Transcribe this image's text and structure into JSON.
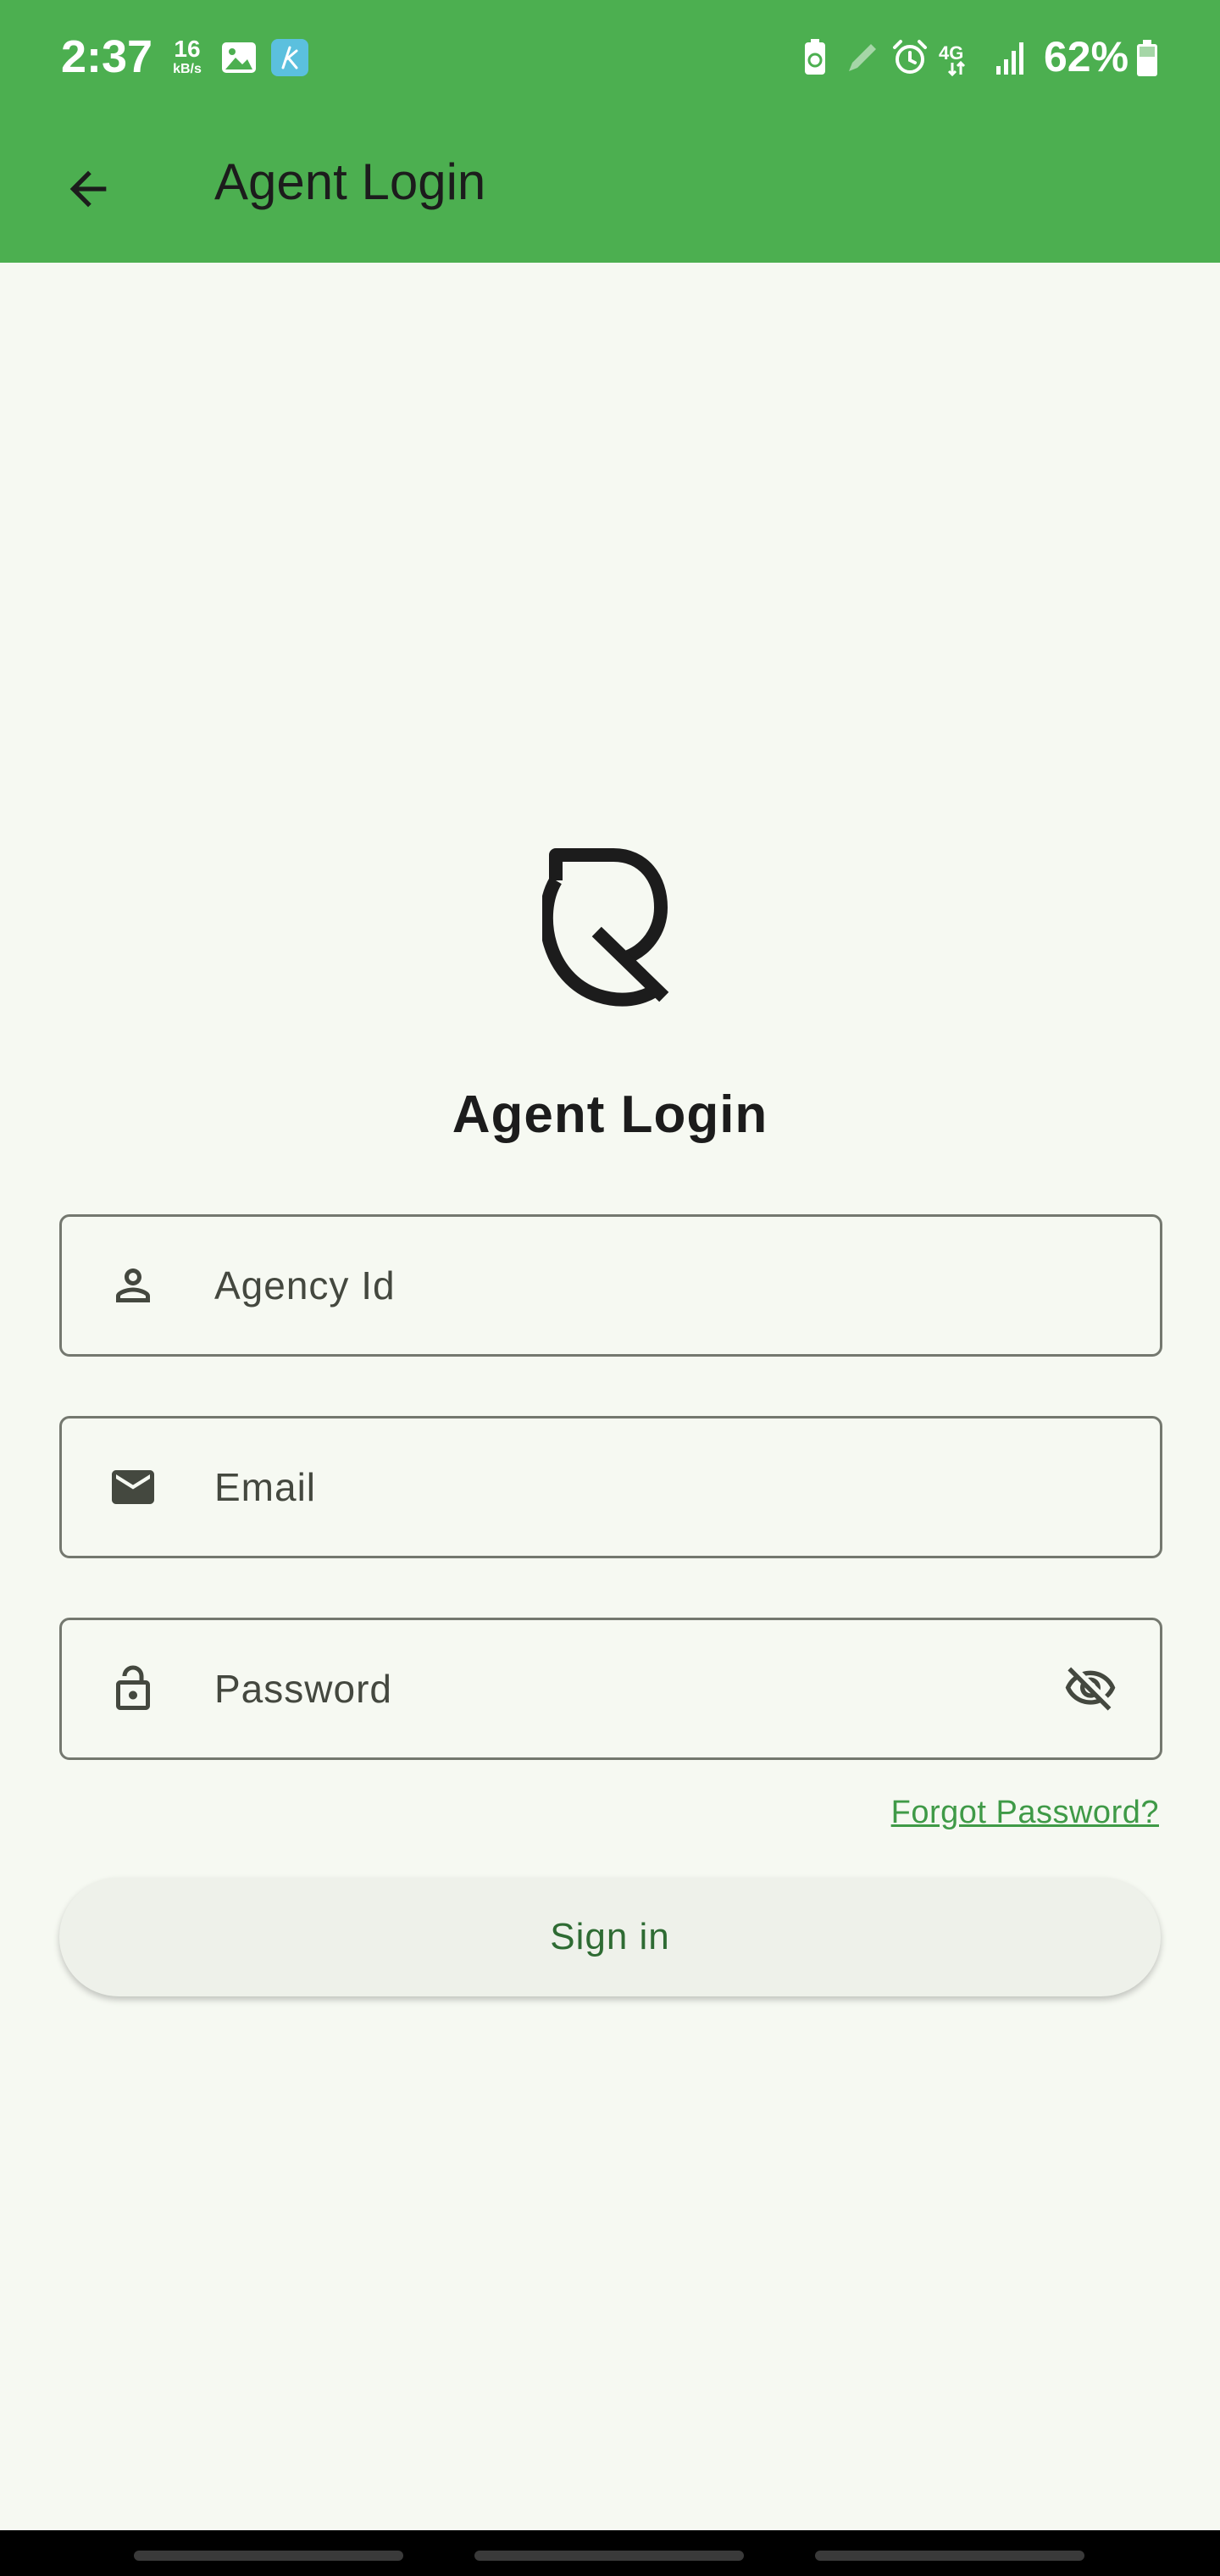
{
  "status_bar": {
    "time": "2:37",
    "speed_value": "16",
    "speed_unit": "kB/s",
    "battery_percent": "62%",
    "icons": [
      "image-icon",
      "app-k-icon",
      "battery-saver-icon",
      "pen-icon",
      "alarm-icon",
      "4g-icon",
      "signal-icon",
      "battery-icon"
    ]
  },
  "app_bar": {
    "title": "Agent Login",
    "back_icon": "arrow-back-icon"
  },
  "main": {
    "heading": "Agent Login",
    "agency_field": {
      "placeholder": "Agency Id",
      "icon": "person-icon"
    },
    "email_field": {
      "placeholder": "Email",
      "icon": "mail-icon"
    },
    "password_field": {
      "placeholder": "Password",
      "icon": "lock-icon",
      "toggle_icon": "eye-off-icon"
    },
    "forgot_password": "Forgot Password?",
    "sign_in": "Sign in"
  },
  "colors": {
    "app_bar": "#4caf50",
    "background": "#f6f9f2",
    "link": "#3f9a47",
    "button_text": "#2e6b33"
  }
}
